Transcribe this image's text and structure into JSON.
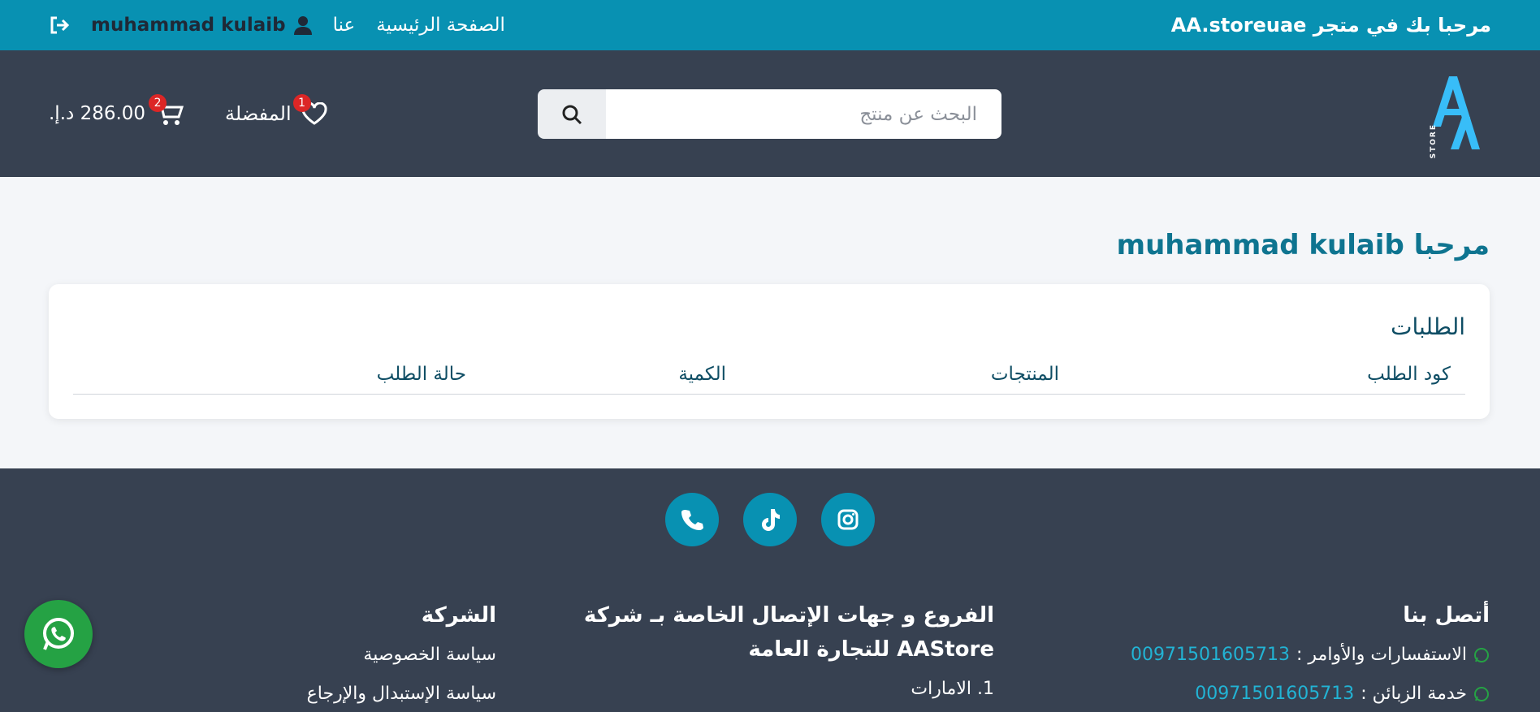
{
  "topbar": {
    "welcome": "مرحبا بك في متجر AA.storeuae",
    "nav": {
      "home": "الصفحة الرئيسية",
      "about": "عنا"
    },
    "user_name": "muhammad kulaib"
  },
  "header": {
    "logo_text": "STORE",
    "search": {
      "placeholder": "البحث عن منتج"
    },
    "favorites": {
      "label": "المفضلة",
      "count": "1"
    },
    "cart": {
      "total": "286.00 د.إ.",
      "count": "2"
    }
  },
  "main": {
    "greeting": "مرحبا muhammad kulaib",
    "orders": {
      "title": "الطلبات",
      "columns": [
        "كود الطلب",
        "المنتجات",
        "الكمية",
        "حالة الطلب"
      ]
    }
  },
  "footer": {
    "contact": {
      "title": "أتصل بنا",
      "line1_label": "الاستفسارات والأوامر :",
      "line1_number": "00971501605713",
      "line2_label": "خدمة الزبائن :",
      "line2_number": "00971501605713"
    },
    "branches": {
      "title": "الفروع و جهات الإتصال الخاصة بـ شركة AAStore للتجارة العامة",
      "item1": "1. الامارات"
    },
    "company": {
      "title": "الشركة",
      "links": [
        "سياسة الخصوصية",
        "سياسة الإستبدال والإرجاع"
      ]
    }
  },
  "colors": {
    "accent": "#0891b2",
    "header": "#374151",
    "whatsapp": "#25a244",
    "badge": "#dc2626"
  }
}
